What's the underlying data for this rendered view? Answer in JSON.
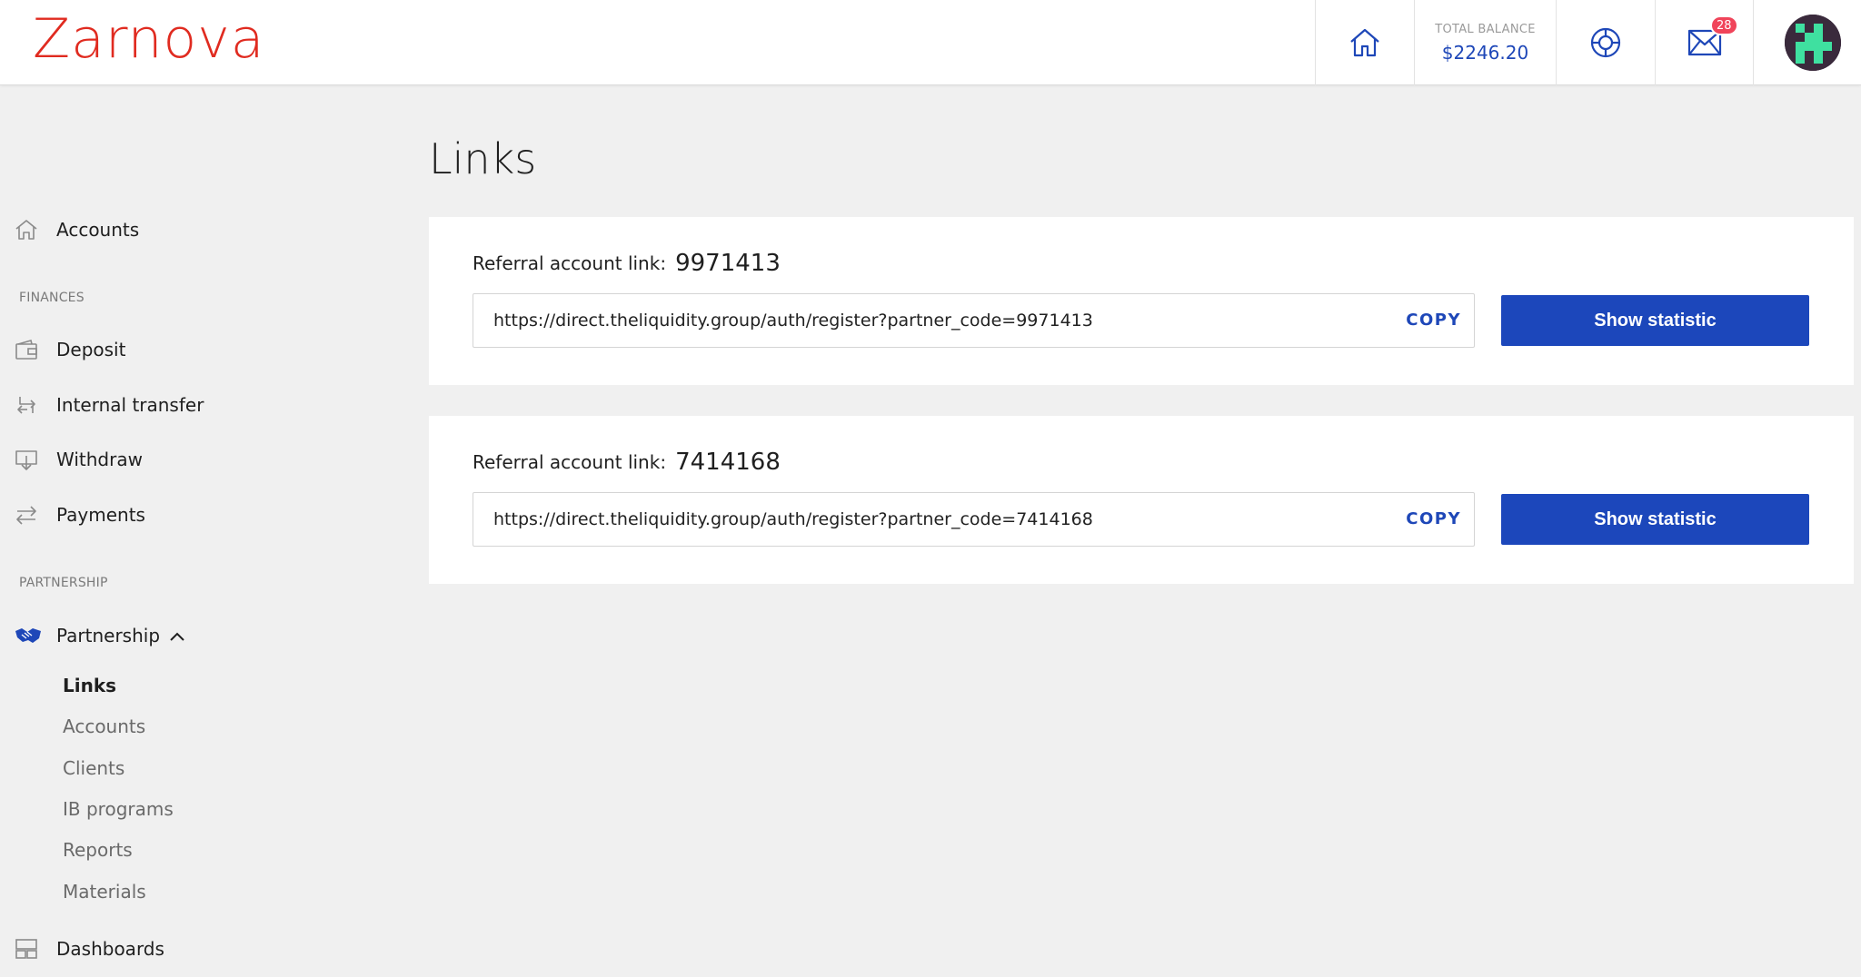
{
  "header": {
    "logo": "Zarnova",
    "balance_label": "TOTAL BALANCE",
    "balance_value": "$2246.20",
    "mail_badge": "28",
    "icons": [
      "home-icon",
      "support-icon",
      "mail-icon"
    ]
  },
  "sidebar": {
    "accounts_label": "Accounts",
    "finances_section": "FINANCES",
    "finances_items": [
      {
        "label": "Deposit",
        "icon": "wallet-icon"
      },
      {
        "label": "Internal transfer",
        "icon": "transfer-icon"
      },
      {
        "label": "Withdraw",
        "icon": "withdraw-icon"
      },
      {
        "label": "Payments",
        "icon": "payments-icon"
      }
    ],
    "partnership_section": "PARTNERSHIP",
    "partnership_label": "Partnership",
    "partnership_sub": [
      "Links",
      "Accounts",
      "Clients",
      "IB programs",
      "Reports",
      "Materials"
    ],
    "active_sub": "Links",
    "dashboards_label": "Dashboards"
  },
  "main": {
    "title": "Links",
    "cards": [
      {
        "label": "Referral account link:",
        "id": "9971413",
        "url": "https://direct.theliquidity.group/auth/register?partner_code=9971413",
        "copy": "COPY",
        "button": "Show statistic"
      },
      {
        "label": "Referral account link:",
        "id": "7414168",
        "url": "https://direct.theliquidity.group/auth/register?partner_code=7414168",
        "copy": "COPY",
        "button": "Show statistic"
      }
    ]
  },
  "colors": {
    "brand_red": "#e02b20",
    "primary_blue": "#1c47bb",
    "badge_red": "#f0445a"
  }
}
